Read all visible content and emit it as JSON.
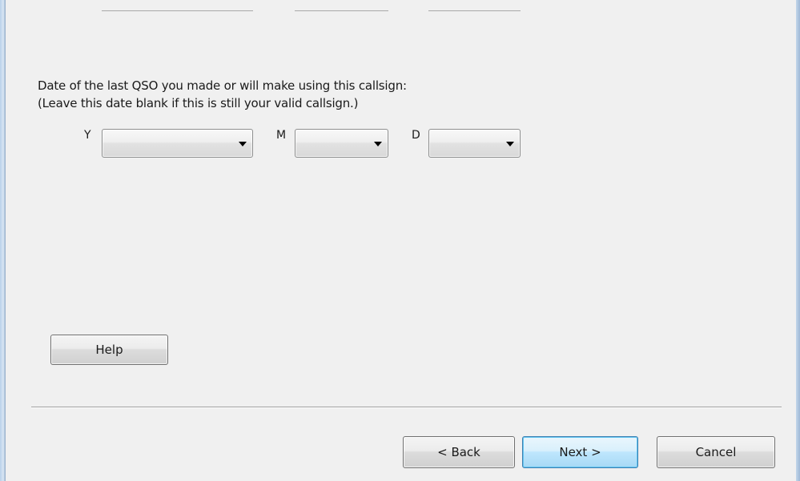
{
  "dialog": {
    "date_prompt_line1": "Date of the last QSO you made or will make using this callsign:",
    "date_prompt_line2": "(Leave this date blank if this is still your valid callsign.)",
    "year_label": "Y",
    "month_label": "M",
    "day_label": "D",
    "year_value": "",
    "month_value": "",
    "day_value": "",
    "help_label": "Help"
  },
  "footer": {
    "back_label": "< Back",
    "next_label": "Next >",
    "cancel_label": "Cancel"
  },
  "icons": {
    "dropdown": "chevron-down-icon"
  },
  "colors": {
    "window_background": "#f0f0f0",
    "default_button_border": "#3c7fb1",
    "window_frame": "#b9d1ea"
  }
}
